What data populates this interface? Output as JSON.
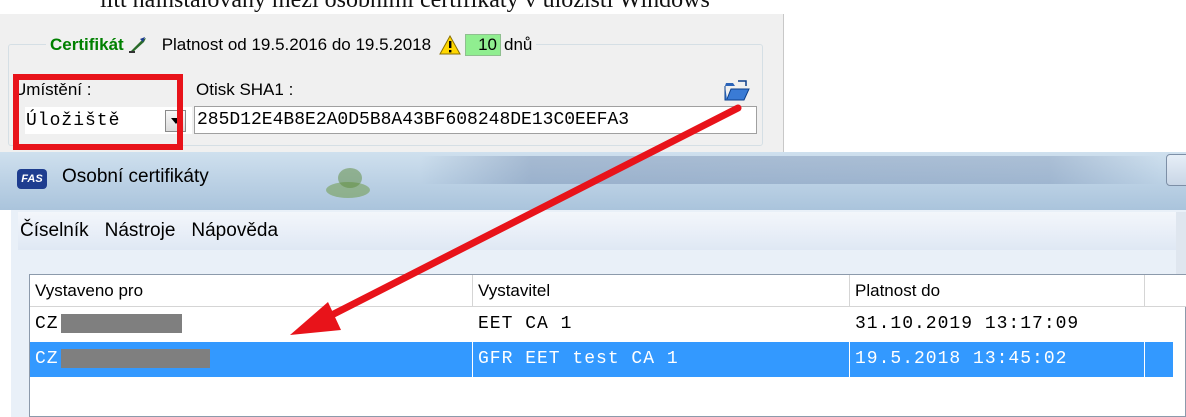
{
  "doc_text": "litt nainstalovaný mezi osobními certifikáty v úložišti Windows",
  "cert_panel": {
    "legend_label": "Certifikát",
    "validity_text": "Platnost od 19.5.2016 do 19.5.2018",
    "days_value": "10",
    "days_unit": "dnů",
    "location_label": "Umístění :",
    "location_value": "Úložiště",
    "sha1_label": "Otisk SHA1 :",
    "sha1_value": "285D12E4B8E2A0D5B8A43BF608248DE13C0EEFA3"
  },
  "window": {
    "app_badge": "FAS",
    "title": "Osobní certifikáty",
    "menu": [
      "Číselník",
      "Nástroje",
      "Nápověda"
    ],
    "columns": [
      "Vystaveno pro",
      "Vystavitel",
      "Platnost do"
    ],
    "rows": [
      {
        "issued_to": "CZ",
        "issuer": "EET CA 1",
        "valid_to": "31.10.2019 13:17:09",
        "selected": false
      },
      {
        "issued_to": "CZ",
        "issuer": "GFR EET test CA 1",
        "valid_to": "19.5.2018 13:45:02",
        "selected": true
      }
    ]
  },
  "colors": {
    "highlight_red": "#e8131a",
    "selection_blue": "#3399ff",
    "days_green": "#90ee90",
    "label_green": "#008000"
  }
}
